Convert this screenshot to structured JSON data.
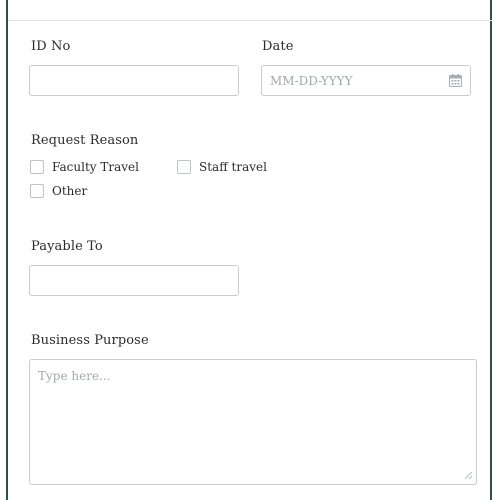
{
  "form": {
    "id_no": {
      "label": "ID No",
      "value": "",
      "placeholder": ""
    },
    "date": {
      "label": "Date",
      "value": "",
      "placeholder": "MM-DD-YYYY"
    },
    "request_reason": {
      "label": "Request Reason",
      "options": [
        {
          "label": "Faculty Travel",
          "checked": false
        },
        {
          "label": "Staff travel",
          "checked": false
        },
        {
          "label": "Other",
          "checked": false
        }
      ]
    },
    "payable_to": {
      "label": "Payable To",
      "value": "",
      "placeholder": ""
    },
    "business_purpose": {
      "label": "Business Purpose",
      "value": "",
      "placeholder": "Type here..."
    }
  },
  "colors": {
    "frame_border": "#2f4f4a",
    "input_border": "#c9ccd0",
    "placeholder": "#a3a8ae",
    "text": "#2b2b2b"
  },
  "icons": {
    "date_field": "calendar-icon",
    "textarea_corner": "resize-grip-icon"
  }
}
